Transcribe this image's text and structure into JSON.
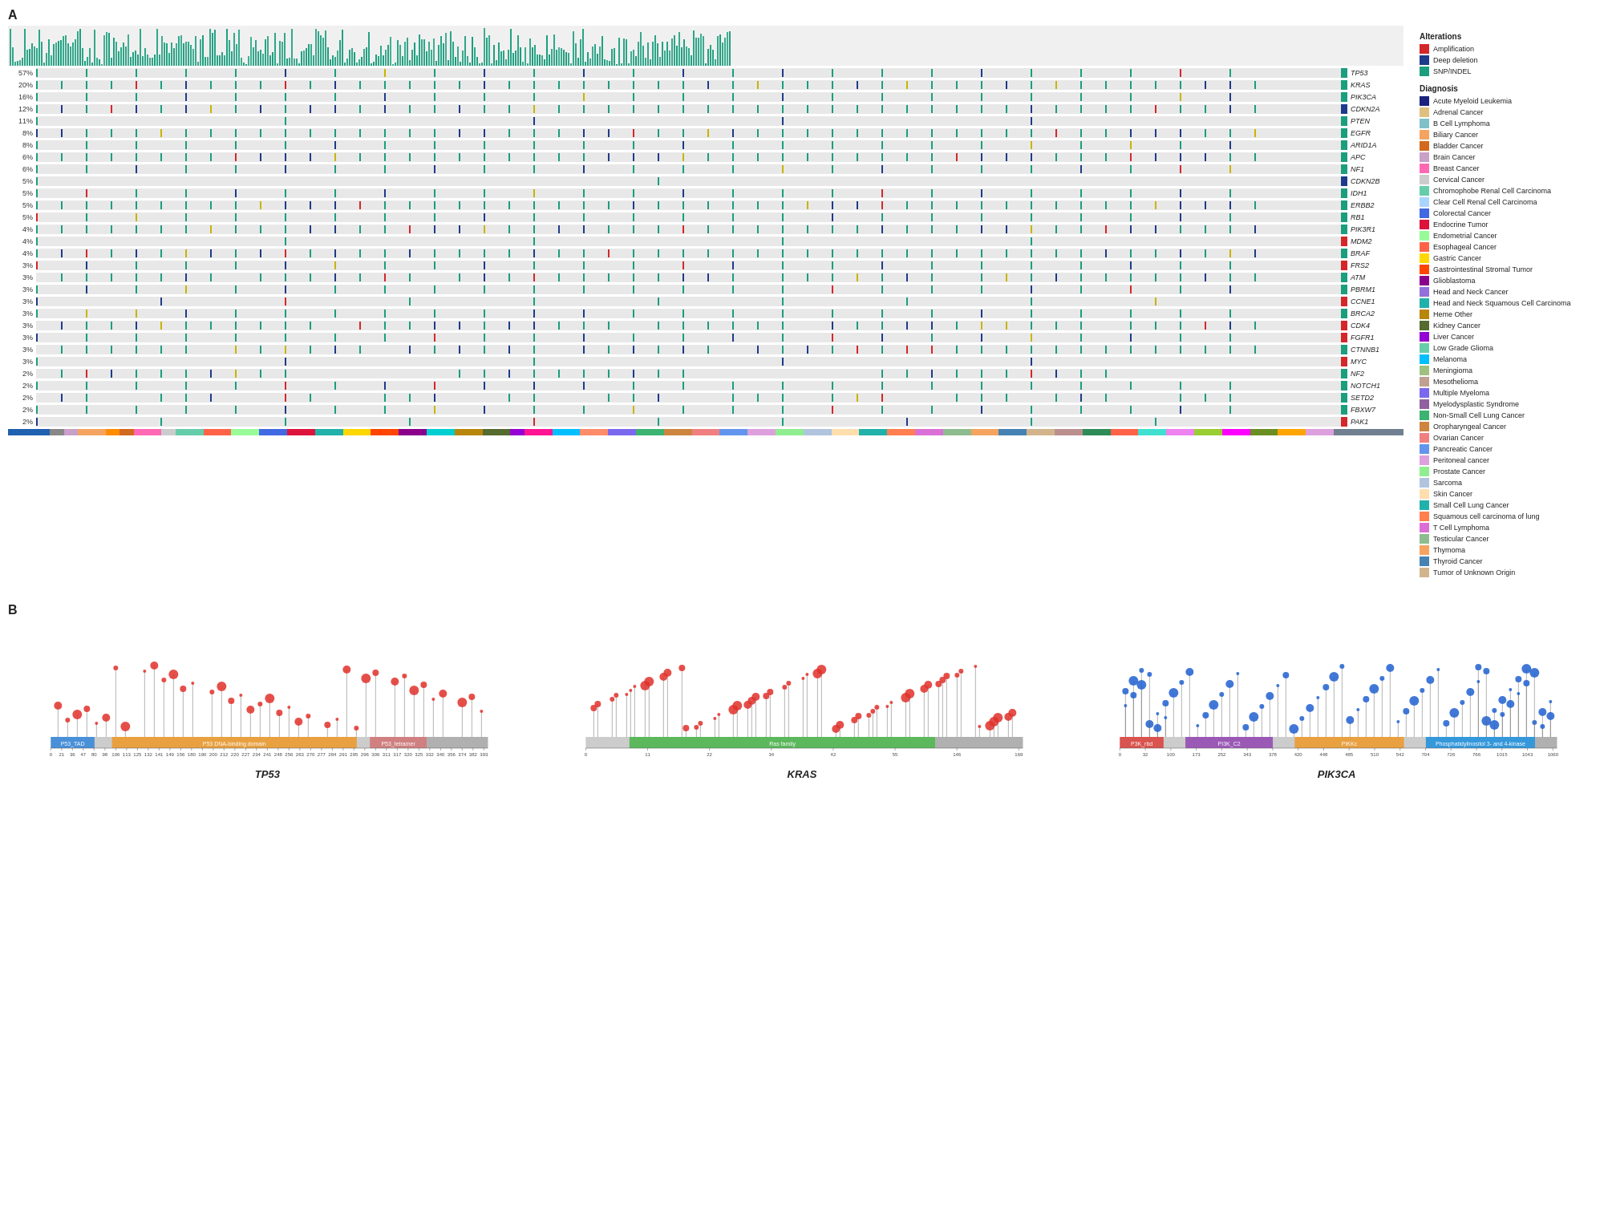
{
  "section_a_label": "A",
  "section_b_label": "B",
  "genes": [
    {
      "pct": "57%",
      "name": "TP53",
      "color": "#1a9e7e"
    },
    {
      "pct": "20%",
      "name": "KRAS",
      "color": "#1a9e7e"
    },
    {
      "pct": "16%",
      "name": "PIK3CA",
      "color": "#1a9e7e"
    },
    {
      "pct": "12%",
      "name": "CDKN2A",
      "color": "#1e3a8a"
    },
    {
      "pct": "11%",
      "name": "PTEN",
      "color": "#1a9e7e"
    },
    {
      "pct": "8%",
      "name": "EGFR",
      "color": "#1a9e7e"
    },
    {
      "pct": "8%",
      "name": "ARID1A",
      "color": "#1a9e7e"
    },
    {
      "pct": "6%",
      "name": "APC",
      "color": "#1a9e7e"
    },
    {
      "pct": "6%",
      "name": "NF1",
      "color": "#1a9e7e"
    },
    {
      "pct": "5%",
      "name": "CDKN2B",
      "color": "#1e3a8a"
    },
    {
      "pct": "5%",
      "name": "IDH1",
      "color": "#1a9e7e"
    },
    {
      "pct": "5%",
      "name": "ERBB2",
      "color": "#1a9e7e"
    },
    {
      "pct": "5%",
      "name": "RB1",
      "color": "#1a9e7e"
    },
    {
      "pct": "4%",
      "name": "PIK3R1",
      "color": "#1a9e7e"
    },
    {
      "pct": "4%",
      "name": "MDM2",
      "color": "#d4272a"
    },
    {
      "pct": "4%",
      "name": "BRAF",
      "color": "#1a9e7e"
    },
    {
      "pct": "3%",
      "name": "FRS2",
      "color": "#d4272a"
    },
    {
      "pct": "3%",
      "name": "ATM",
      "color": "#1a9e7e"
    },
    {
      "pct": "3%",
      "name": "PBRM1",
      "color": "#1a9e7e"
    },
    {
      "pct": "3%",
      "name": "CCNE1",
      "color": "#d4272a"
    },
    {
      "pct": "3%",
      "name": "BRCA2",
      "color": "#1a9e7e"
    },
    {
      "pct": "3%",
      "name": "CDK4",
      "color": "#d4272a"
    },
    {
      "pct": "3%",
      "name": "FGFR1",
      "color": "#d4272a"
    },
    {
      "pct": "3%",
      "name": "CTNNB1",
      "color": "#1a9e7e"
    },
    {
      "pct": "3%",
      "name": "MYC",
      "color": "#d4272a"
    },
    {
      "pct": "2%",
      "name": "NF2",
      "color": "#1a9e7e"
    },
    {
      "pct": "2%",
      "name": "NOTCH1",
      "color": "#1a9e7e"
    },
    {
      "pct": "2%",
      "name": "SETD2",
      "color": "#1a9e7e"
    },
    {
      "pct": "2%",
      "name": "FBXW7",
      "color": "#1a9e7e"
    },
    {
      "pct": "2%",
      "name": "PAK1",
      "color": "#d4272a"
    }
  ],
  "alterations_legend_title": "Alterations",
  "alteration_types": [
    {
      "label": "Amplification",
      "color": "#d4272a"
    },
    {
      "label": "Deep deletion",
      "color": "#1e3a8a"
    },
    {
      "label": "SNP/INDEL",
      "color": "#1a9e7e"
    }
  ],
  "diagnosis_legend_title": "Diagnosis",
  "diagnosis_items": [
    {
      "label": "Acute Myeloid Leukemia",
      "color": "#1a237e"
    },
    {
      "label": "Adrenal Cancer",
      "color": "#e0c080"
    },
    {
      "label": "B Cell Lymphoma",
      "color": "#80c0c8"
    },
    {
      "label": "Biliary Cancer",
      "color": "#f4a460"
    },
    {
      "label": "Bladder Cancer",
      "color": "#d2691e"
    },
    {
      "label": "Brain Cancer",
      "color": "#c8a0c8"
    },
    {
      "label": "Breast Cancer",
      "color": "#ff69b4"
    },
    {
      "label": "Cervical Cancer",
      "color": "#cccccc"
    },
    {
      "label": "Chromophobe Renal Cell Carcinoma",
      "color": "#66cdaa"
    },
    {
      "label": "Clear Cell Renal Cell Carcinoma",
      "color": "#aad4ff"
    },
    {
      "label": "Colorectal Cancer",
      "color": "#4169e1"
    },
    {
      "label": "Endocrine Tumor",
      "color": "#dc143c"
    },
    {
      "label": "Endometrial Cancer",
      "color": "#98fb98"
    },
    {
      "label": "Esophageal Cancer",
      "color": "#ff6347"
    },
    {
      "label": "Gastric Cancer",
      "color": "#ffd700"
    },
    {
      "label": "Gastrointestinal Stromal Tumor",
      "color": "#ff4500"
    },
    {
      "label": "Glioblastoma",
      "color": "#8b008b"
    },
    {
      "label": "Head and Neck Cancer",
      "color": "#9370db"
    },
    {
      "label": "Head and Neck Squamous Cell Carcinoma",
      "color": "#20b2aa"
    },
    {
      "label": "Heme Other",
      "color": "#b8860b"
    },
    {
      "label": "Kidney Cancer",
      "color": "#556b2f"
    },
    {
      "label": "Liver Cancer",
      "color": "#9400d3"
    },
    {
      "label": "Low Grade Glioma",
      "color": "#66cdaa"
    },
    {
      "label": "Melanoma",
      "color": "#00bfff"
    },
    {
      "label": "Meningioma",
      "color": "#a0c080"
    },
    {
      "label": "Mesothelioma",
      "color": "#c0a090"
    },
    {
      "label": "Multiple Myeloma",
      "color": "#7b68ee"
    },
    {
      "label": "Myelodysplastic Syndrome",
      "color": "#9060a0"
    },
    {
      "label": "Non-Small Cell Lung Cancer",
      "color": "#3cb371"
    },
    {
      "label": "Oropharyngeal Cancer",
      "color": "#cd853f"
    },
    {
      "label": "Ovarian Cancer",
      "color": "#f08080"
    },
    {
      "label": "Pancreatic Cancer",
      "color": "#6495ed"
    },
    {
      "label": "Peritoneal cancer",
      "color": "#dda0dd"
    },
    {
      "label": "Prostate Cancer",
      "color": "#90ee90"
    },
    {
      "label": "Sarcoma",
      "color": "#b0c4de"
    },
    {
      "label": "Skin Cancer",
      "color": "#ffdead"
    },
    {
      "label": "Small Cell Lung Cancer",
      "color": "#20b2aa"
    },
    {
      "label": "Squamous cell carcinoma of lung",
      "color": "#ff7f50"
    },
    {
      "label": "T Cell Lymphoma",
      "color": "#da70d6"
    },
    {
      "label": "Testicular Cancer",
      "color": "#8fbc8f"
    },
    {
      "label": "Thymoma",
      "color": "#f4a460"
    },
    {
      "label": "Thyroid Cancer",
      "color": "#4682b4"
    },
    {
      "label": "Tumor of Unknown Origin",
      "color": "#d2b48c"
    }
  ],
  "lollipop_panels": [
    {
      "gene": "TP53",
      "domains": [
        {
          "label": "P53_TAD",
          "color": "#4a90d9",
          "start": 0,
          "end": 10
        },
        {
          "label": "P53 DNA-binding domain",
          "color": "#e8a040",
          "start": 14,
          "end": 70
        },
        {
          "label": "P53_tetramer",
          "color": "#d08080",
          "start": 73,
          "end": 86
        },
        {
          "label": "",
          "color": "#b0b0b0",
          "start": 86,
          "end": 100
        }
      ],
      "axis_labels": [
        "0",
        "21",
        "36",
        "47",
        "80",
        "98",
        "106",
        "113",
        "125",
        "132",
        "141",
        "149",
        "156",
        "180",
        "190",
        "200",
        "212",
        "220",
        "227",
        "234",
        "241",
        "248",
        "256",
        "263",
        "270",
        "277",
        "284",
        "291",
        "295",
        "296",
        "306",
        "311",
        "317",
        "320",
        "325",
        "332",
        "340",
        "356",
        "374",
        "382",
        "393"
      ]
    },
    {
      "gene": "KRAS",
      "domains": [
        {
          "label": "Ras family",
          "color": "#5cb85c",
          "start": 10,
          "end": 80
        },
        {
          "label": "",
          "color": "#b0b0b0",
          "start": 80,
          "end": 100
        }
      ],
      "axis_labels": [
        "0",
        "11",
        "22",
        "34",
        "42",
        "55",
        "146",
        "169"
      ]
    },
    {
      "gene": "PIK3CA",
      "domains": [
        {
          "label": "P3K_rbd",
          "color": "#d9534f",
          "start": 0,
          "end": 10
        },
        {
          "label": "PI3K_C2",
          "color": "#9b59b6",
          "start": 15,
          "end": 35
        },
        {
          "label": "PIKKc",
          "color": "#e8a040",
          "start": 40,
          "end": 65
        },
        {
          "label": "Phosphatidylinositol 3- and 4-kinase",
          "color": "#3498db",
          "start": 70,
          "end": 95
        },
        {
          "label": "",
          "color": "#b0b0b0",
          "start": 95,
          "end": 100
        }
      ],
      "axis_labels": [
        "0",
        "32",
        "100",
        "173",
        "252",
        "343",
        "378",
        "420",
        "448",
        "485",
        "510",
        "542",
        "704",
        "726",
        "766",
        "1015",
        "1043",
        "1060"
      ]
    }
  ]
}
